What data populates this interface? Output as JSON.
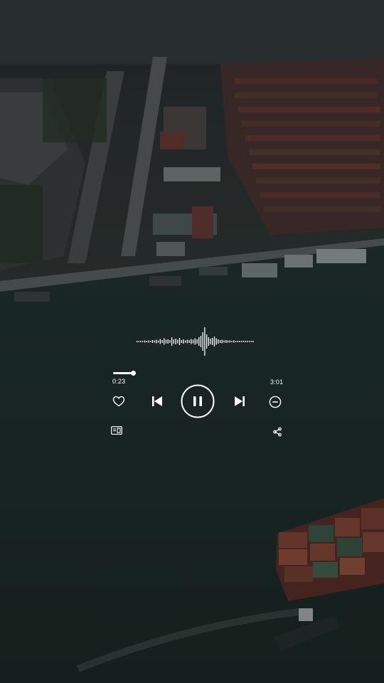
{
  "player": {
    "elapsed_time": "0:23",
    "total_time": "3:01",
    "progress": 0.127,
    "state": "playing",
    "accent_color": "#ffffff"
  },
  "icons": {
    "like": "heart-icon",
    "previous": "skip-previous-icon",
    "pause": "pause-icon",
    "next": "skip-next-icon",
    "remove": "minus-circle-icon",
    "lyrics": "lyrics-icon",
    "share": "share-icon"
  }
}
